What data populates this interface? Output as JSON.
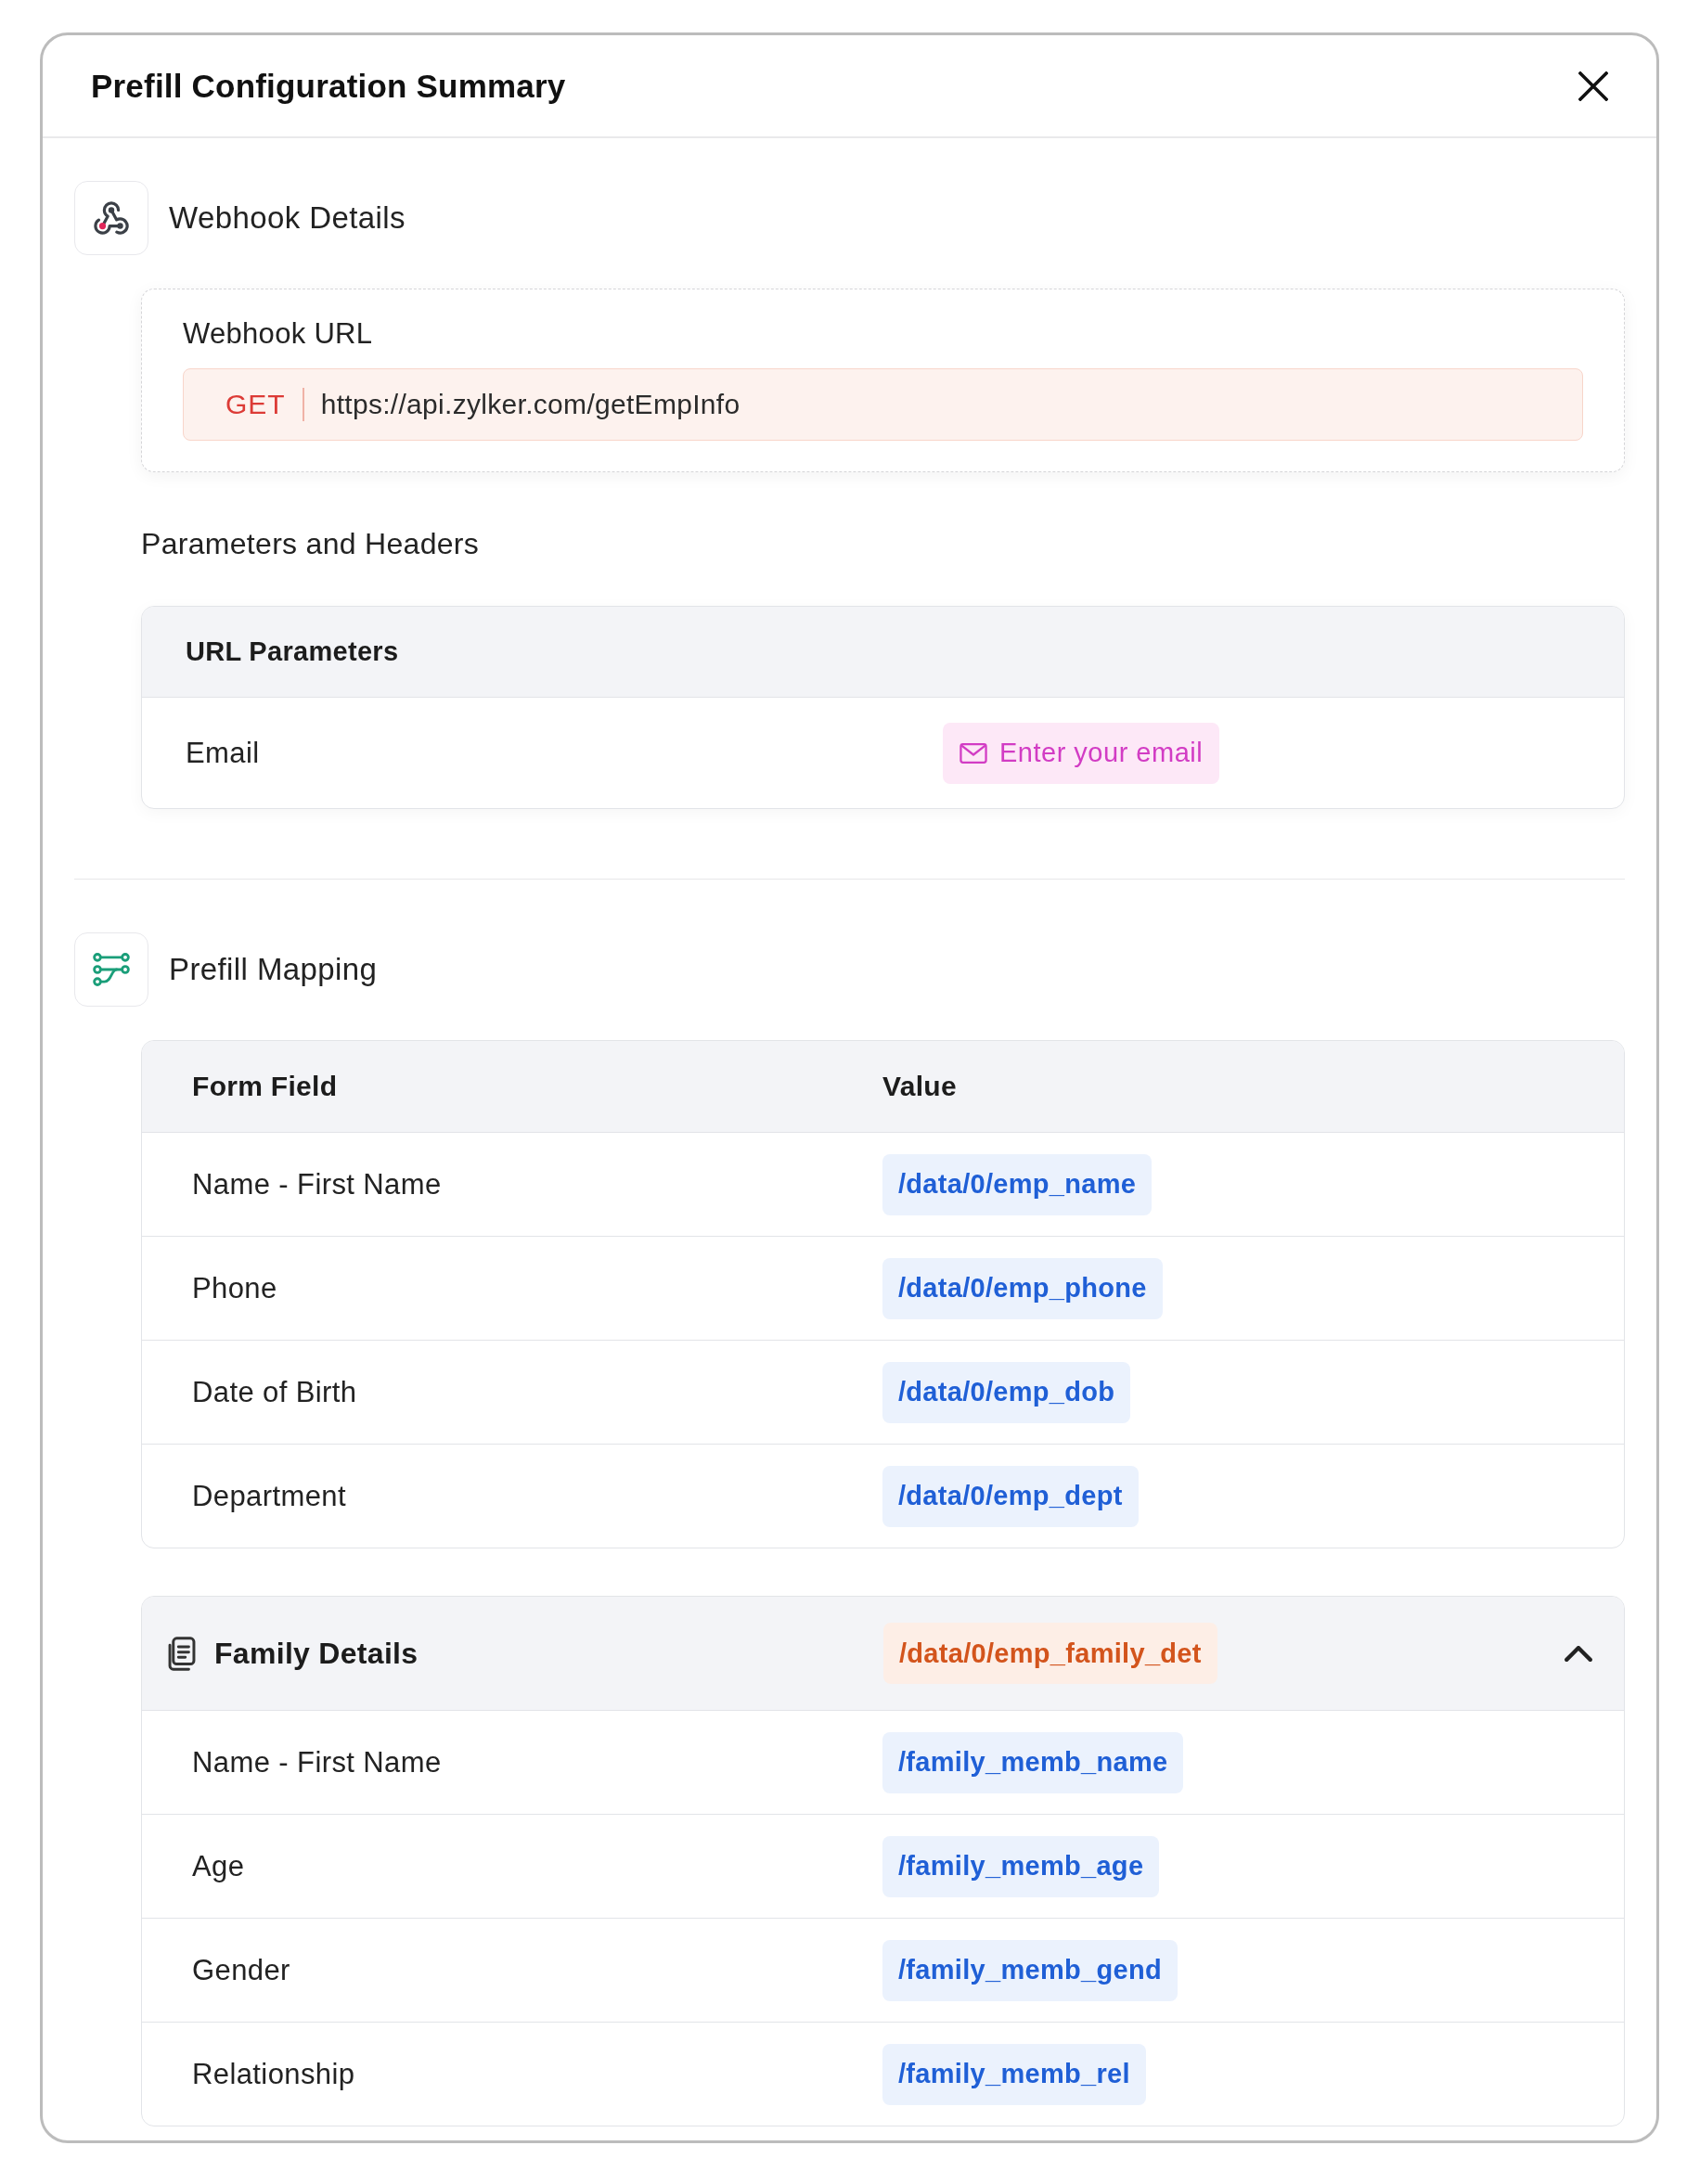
{
  "dialog": {
    "title": "Prefill Configuration Summary"
  },
  "webhook": {
    "heading": "Webhook Details",
    "url_label": "Webhook URL",
    "method": "GET",
    "url": "https://api.zylker.com/getEmpInfo"
  },
  "parameters": {
    "heading": "Parameters and Headers",
    "table_title": "URL Parameters",
    "rows": [
      {
        "name": "Email",
        "value": "Enter your email"
      }
    ]
  },
  "mapping": {
    "heading": "Prefill Mapping",
    "columns": [
      "Form Field",
      "Value"
    ],
    "rows": [
      {
        "field": "Name - First Name",
        "value": "/data/0/emp_name"
      },
      {
        "field": "Phone",
        "value": "/data/0/emp_phone"
      },
      {
        "field": "Date of Birth",
        "value": "/data/0/emp_dob"
      },
      {
        "field": "Department",
        "value": "/data/0/emp_dept"
      }
    ],
    "groups": [
      {
        "title": "Family Details",
        "value": "/data/0/emp_family_det",
        "expanded": true,
        "rows": [
          {
            "field": "Name - First Name",
            "value": "/family_memb_name"
          },
          {
            "field": "Age",
            "value": "/family_memb_age"
          },
          {
            "field": "Gender",
            "value": "/family_memb_gend"
          },
          {
            "field": "Relationship",
            "value": "/family_memb_rel"
          }
        ]
      }
    ]
  }
}
